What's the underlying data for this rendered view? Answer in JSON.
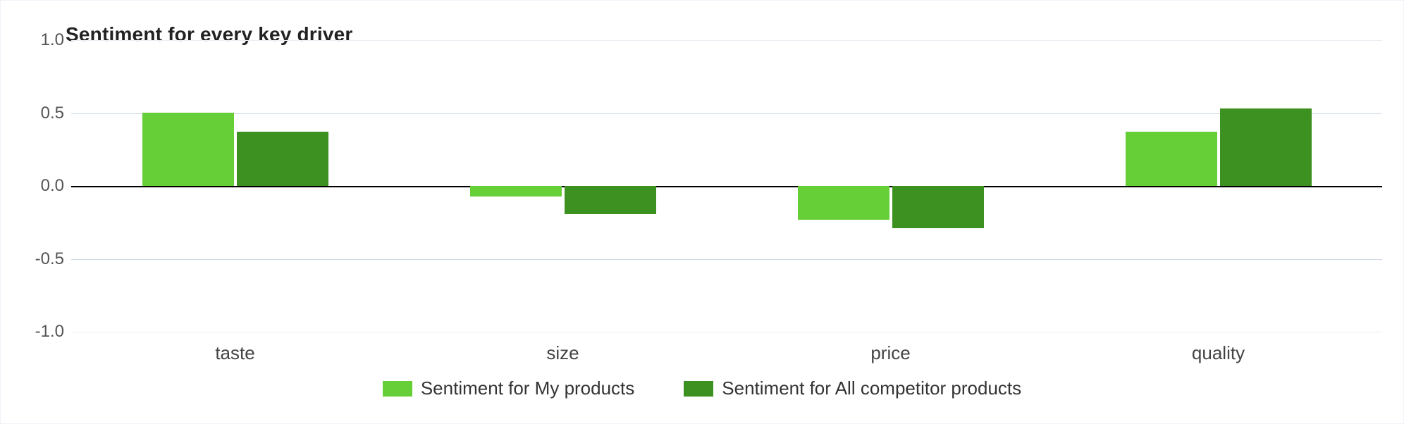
{
  "chart_data": {
    "type": "bar",
    "title": "Sentiment for every key driver",
    "categories": [
      "taste",
      "size",
      "price",
      "quality"
    ],
    "series": [
      {
        "name": "Sentiment for My products",
        "values": [
          0.5,
          -0.07,
          -0.23,
          0.37
        ]
      },
      {
        "name": "Sentiment for All competitor products",
        "values": [
          0.37,
          -0.19,
          -0.29,
          0.53
        ]
      }
    ],
    "ylim": [
      -1.0,
      1.0
    ],
    "yticks": [
      -1.0,
      -0.5,
      0.0,
      0.5,
      1.0
    ],
    "ytick_labels": [
      "-1.0",
      "-0.5",
      "0.0",
      "0.5",
      "1.0"
    ],
    "colors": {
      "series0": "#66cf38",
      "series1": "#3d9120"
    }
  }
}
